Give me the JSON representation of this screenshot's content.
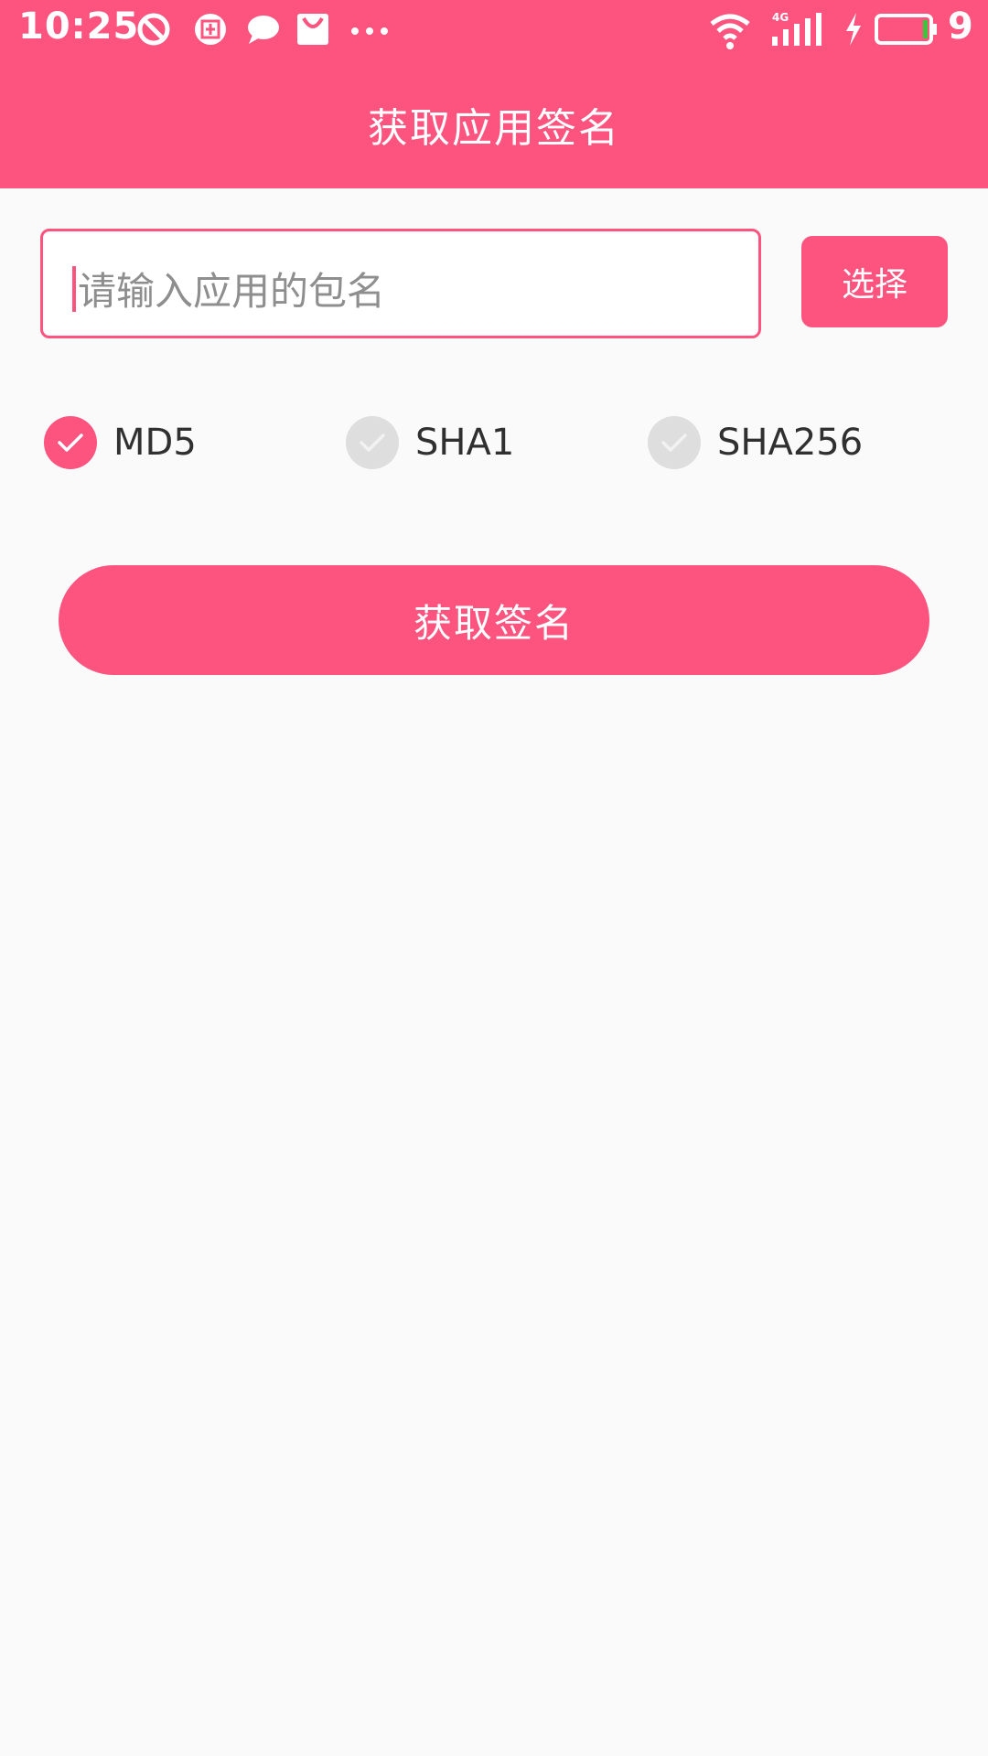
{
  "status_bar": {
    "time": "10:25",
    "network": "4G",
    "battery_level": "9",
    "icons": [
      "dnd-icon",
      "meituan-icon",
      "chat-bubble-icon",
      "shopping-bag-icon",
      "more-dots-icon",
      "wifi-icon",
      "signal-icon",
      "charging-icon",
      "battery-icon"
    ]
  },
  "app_bar": {
    "title": "获取应用签名"
  },
  "package_input": {
    "placeholder": "请输入应用的包名",
    "value": ""
  },
  "select_button": {
    "label": "选择"
  },
  "hash_options": [
    {
      "label": "MD5",
      "checked": true
    },
    {
      "label": "SHA1",
      "checked": false
    },
    {
      "label": "SHA256",
      "checked": false
    }
  ],
  "get_signature_button": {
    "label": "获取签名"
  },
  "colors": {
    "accent": "#fd537f",
    "background": "#fafafa",
    "unchecked": "#dedede"
  }
}
